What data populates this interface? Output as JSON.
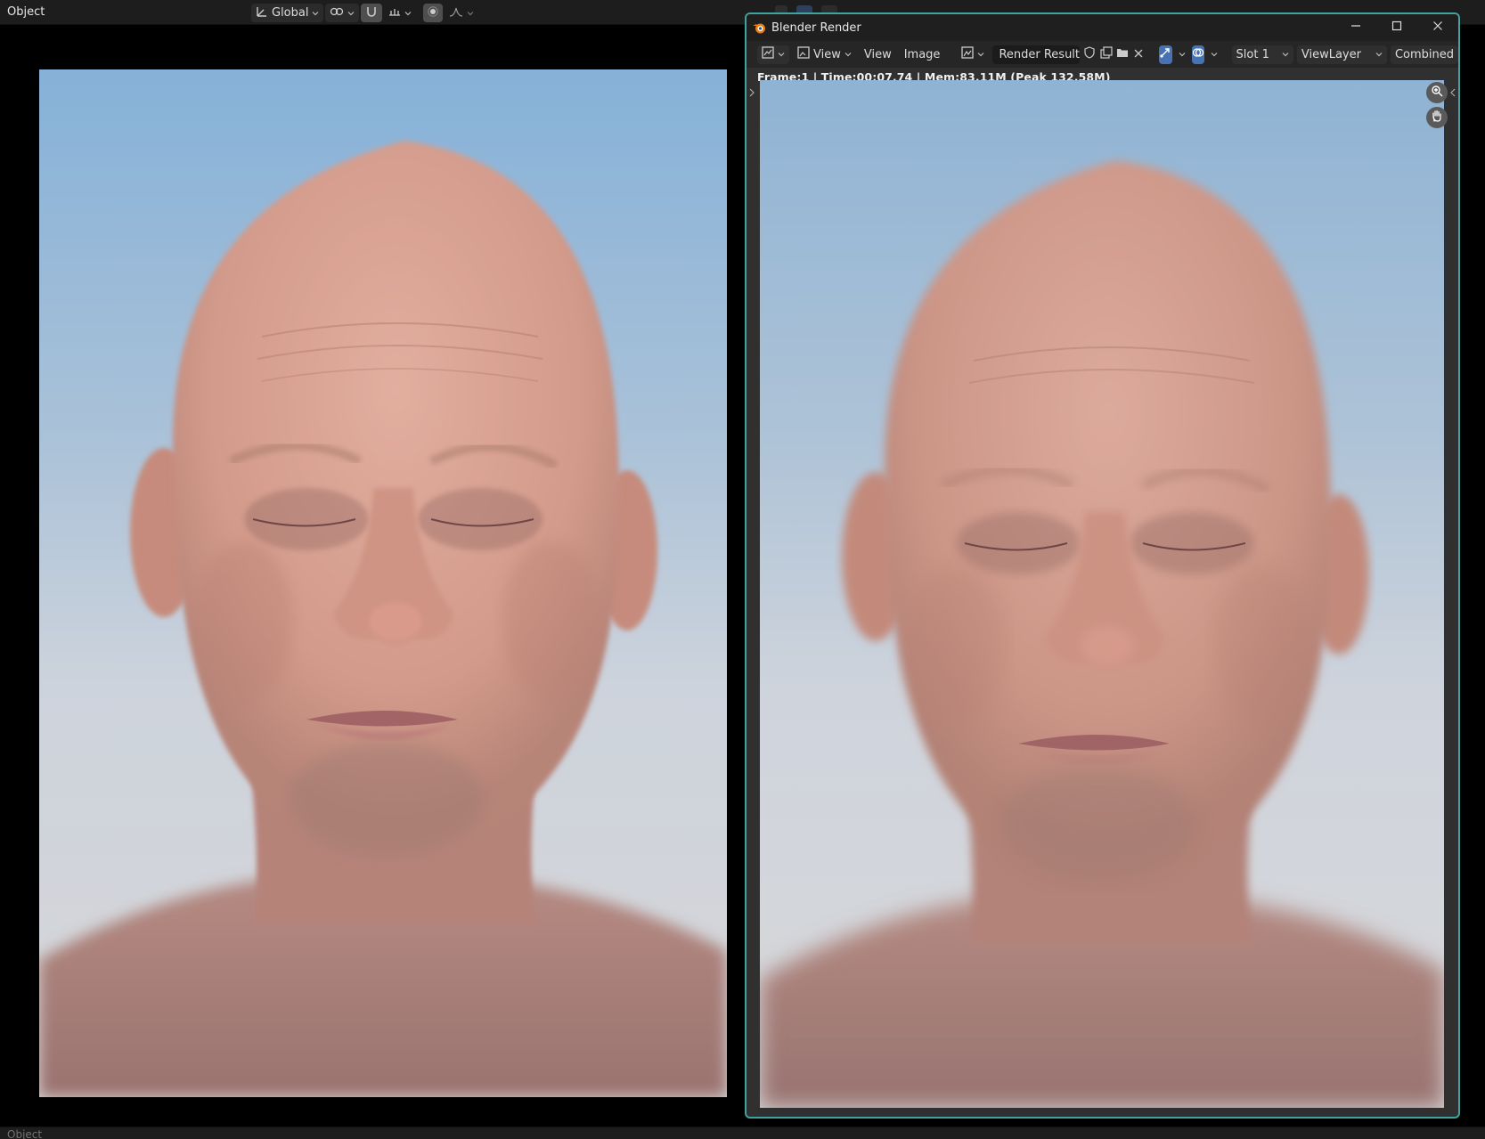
{
  "viewport_header": {
    "mode": "Object",
    "transform_orientation": "Global"
  },
  "bottom_strip": {
    "mode": "Object"
  },
  "render_window": {
    "title": "Blender Render",
    "header": {
      "view_menu": "View",
      "view_menu_2": "View",
      "image_menu": "Image",
      "image_name": "Render Result",
      "slot": "Slot 1",
      "view_layer": "ViewLayer",
      "pass": "Combined"
    },
    "info": "Frame:1 | Time:00:07.74 | Mem:83.11M (Peak 132.58M)"
  },
  "colors": {
    "accent_border": "#3fa3a0",
    "active_blue": "#4772b3",
    "sky_top": "#84b0d6",
    "sky_bottom": "#d3d3d6",
    "skin": "#d79c8c"
  }
}
